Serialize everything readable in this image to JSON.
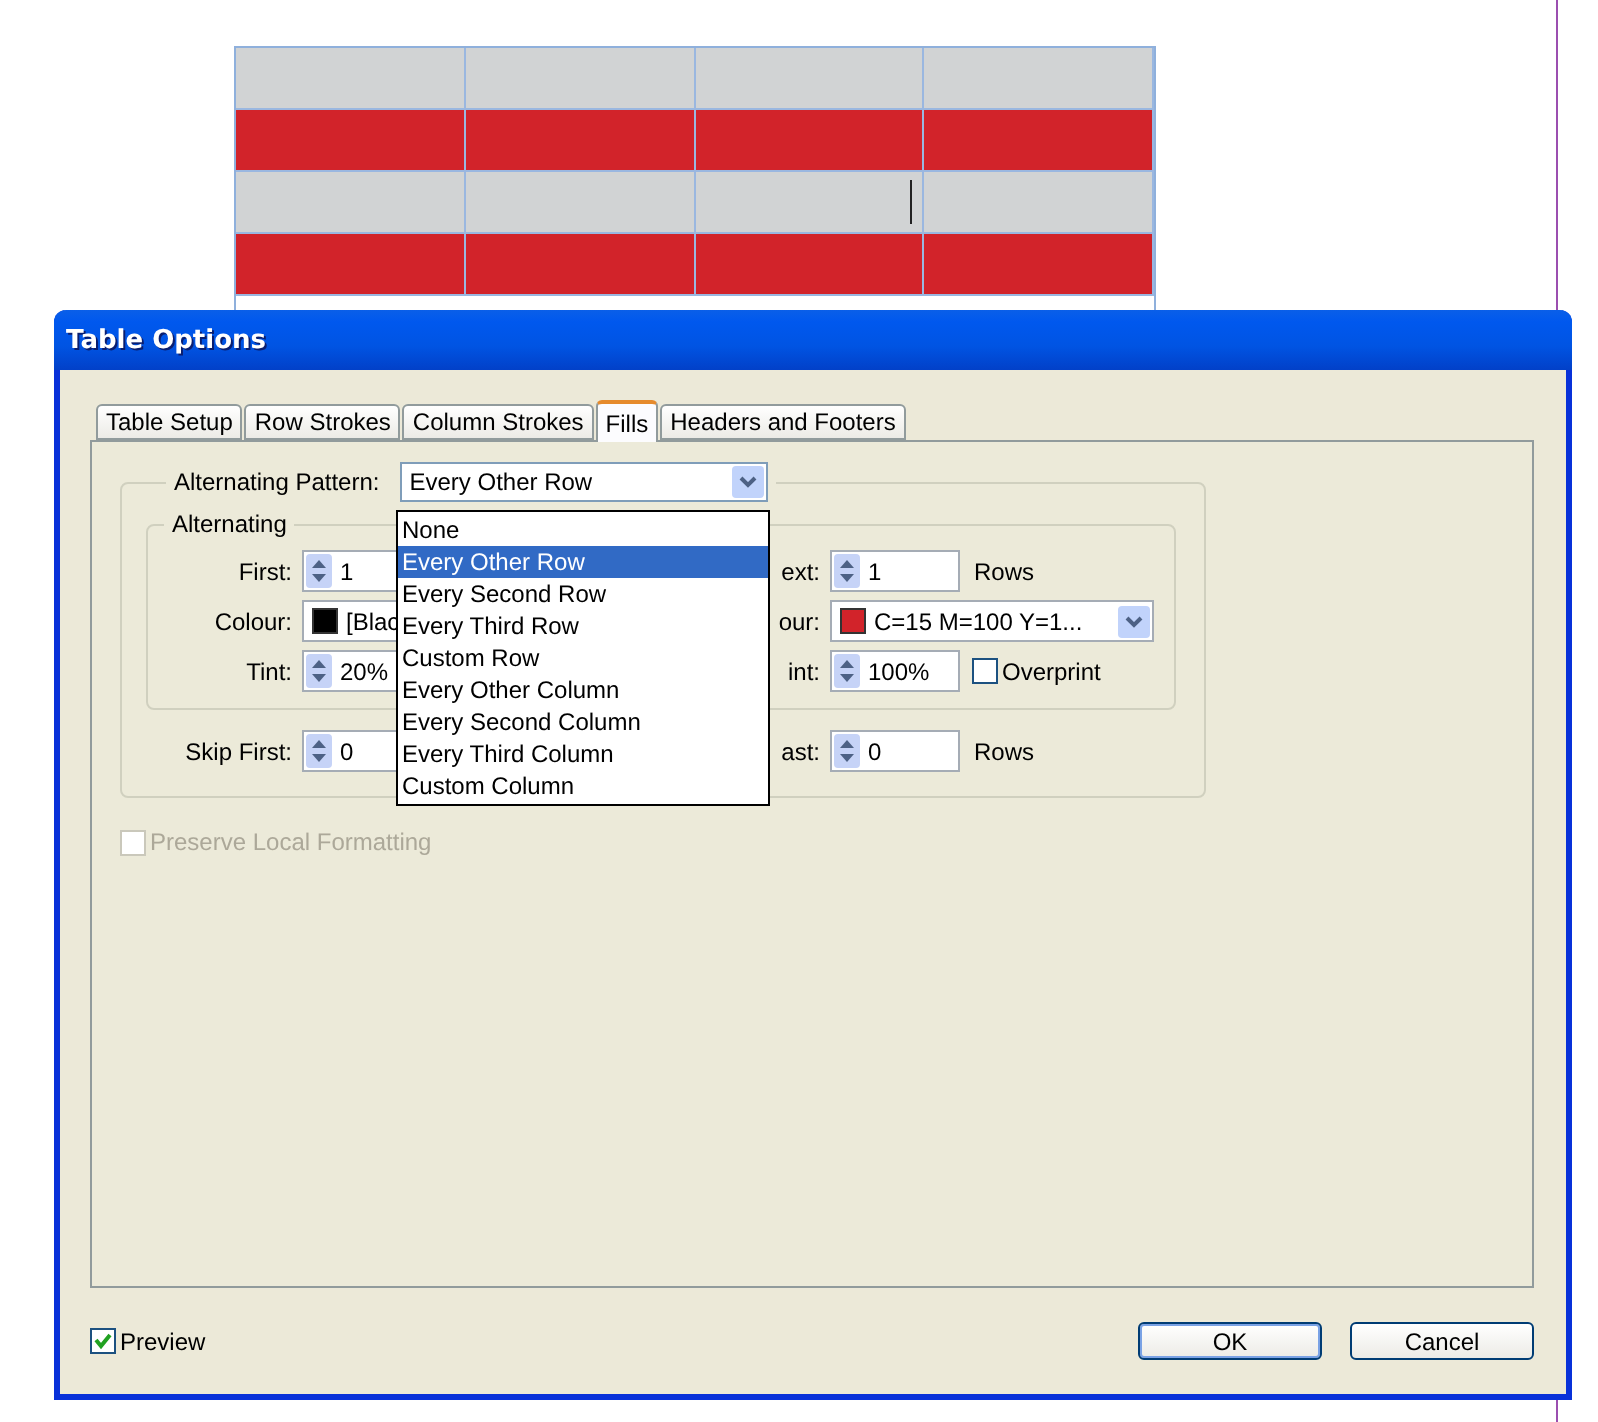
{
  "canvas_table": {
    "rows": [
      {
        "color": "#d1d3d4"
      },
      {
        "color": "#d2232a"
      },
      {
        "color": "#d1d3d4"
      },
      {
        "color": "#d2232a"
      }
    ]
  },
  "dialog": {
    "title": "Table Options",
    "tabs": [
      {
        "label": "Table Setup",
        "selected": false
      },
      {
        "label": "Row Strokes",
        "selected": false
      },
      {
        "label": "Column Strokes",
        "selected": false
      },
      {
        "label": "Fills",
        "selected": true
      },
      {
        "label": "Headers and Footers",
        "selected": false
      }
    ],
    "alternating_pattern": {
      "label": "Alternating Pattern:",
      "value": "Every Other Row",
      "expanded": true,
      "options": [
        {
          "label": "None",
          "selected": false
        },
        {
          "label": "Every Other Row",
          "selected": true
        },
        {
          "label": "Every Second Row",
          "selected": false
        },
        {
          "label": "Every Third Row",
          "selected": false
        },
        {
          "label": "Custom Row",
          "selected": false
        },
        {
          "label": "Every Other Column",
          "selected": false
        },
        {
          "label": "Every Second Column",
          "selected": false
        },
        {
          "label": "Every Third Column",
          "selected": false
        },
        {
          "label": "Custom Column",
          "selected": false
        }
      ]
    },
    "alternating": {
      "legend": "Alternating",
      "rows": [
        {
          "left": {
            "kind": "spinner",
            "label": "First:",
            "value": "1"
          },
          "right": {
            "kind": "spinner",
            "label": "ext:",
            "value": "1",
            "unit": "Rows"
          }
        },
        {
          "left": {
            "kind": "swatch",
            "label": "Colour:",
            "color": "#000000",
            "value": "[Blac"
          },
          "right": {
            "kind": "swatch",
            "label": "our:",
            "color": "#d2232a",
            "value": "C=15 M=100 Y=1..."
          }
        },
        {
          "left": {
            "kind": "spinner",
            "label": "Tint:",
            "value": "20%"
          },
          "right": {
            "kind": "spinner",
            "label": "int:",
            "value": "100%",
            "checkbox": {
              "label": "Overprint",
              "checked": false
            }
          }
        }
      ]
    },
    "skip": {
      "left": {
        "kind": "spinner",
        "label": "Skip First:",
        "value": "0"
      },
      "right": {
        "kind": "spinner",
        "label": "ast:",
        "value": "0",
        "unit": "Rows"
      }
    },
    "preserve_local_formatting": {
      "label": "Preserve Local Formatting",
      "checked": false,
      "disabled": true
    },
    "preview": {
      "label": "Preview",
      "checked": true
    },
    "buttons": [
      {
        "label": "OK",
        "default": true
      },
      {
        "label": "Cancel",
        "default": false
      }
    ]
  }
}
